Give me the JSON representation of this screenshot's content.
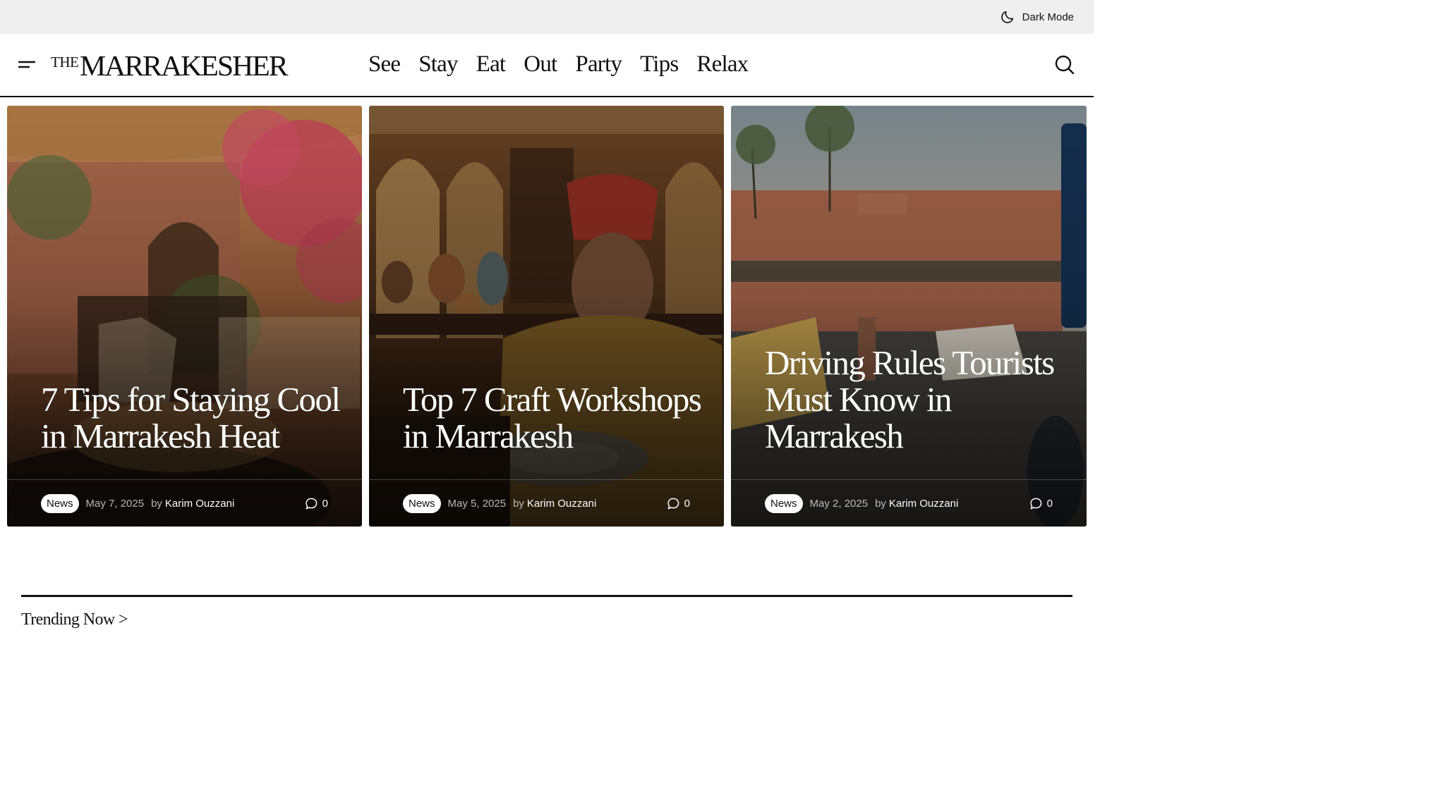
{
  "topbar": {
    "dark_mode_label": "Dark Mode",
    "dark_mode_icon": "moon-icon"
  },
  "header": {
    "logo_the": "THE",
    "logo_name": "MARRAKESHER",
    "nav": [
      "See",
      "Stay",
      "Eat",
      "Out",
      "Party",
      "Tips",
      "Relax"
    ],
    "menu_icon": "hamburger-menu-icon",
    "search_icon": "search-icon"
  },
  "cards": [
    {
      "title": "7 Tips for Staying Cool in Marrakesh Heat",
      "category": "News",
      "date": "May 7, 2025",
      "by": "by",
      "author": "Karim Ouzzani",
      "comments": "0",
      "image": "courtyard-cafe-with-bougainvillea"
    },
    {
      "title": "Top 7 Craft Workshops in Marrakesh",
      "category": "News",
      "date": "May 5, 2025",
      "by": "by",
      "author": "Karim Ouzzani",
      "comments": "0",
      "image": "artisan-painting-pottery"
    },
    {
      "title": "Driving Rules Tourists Must Know in Marrakesh",
      "category": "News",
      "date": "May 2, 2025",
      "by": "by",
      "author": "Karim Ouzzani",
      "comments": "0",
      "image": "marrakesh-street-traffic"
    }
  ],
  "trending": {
    "label": "Trending Now >"
  },
  "colors": {
    "topbar_bg": "#efefef",
    "text": "#111111",
    "badge_bg": "#ffffff"
  }
}
